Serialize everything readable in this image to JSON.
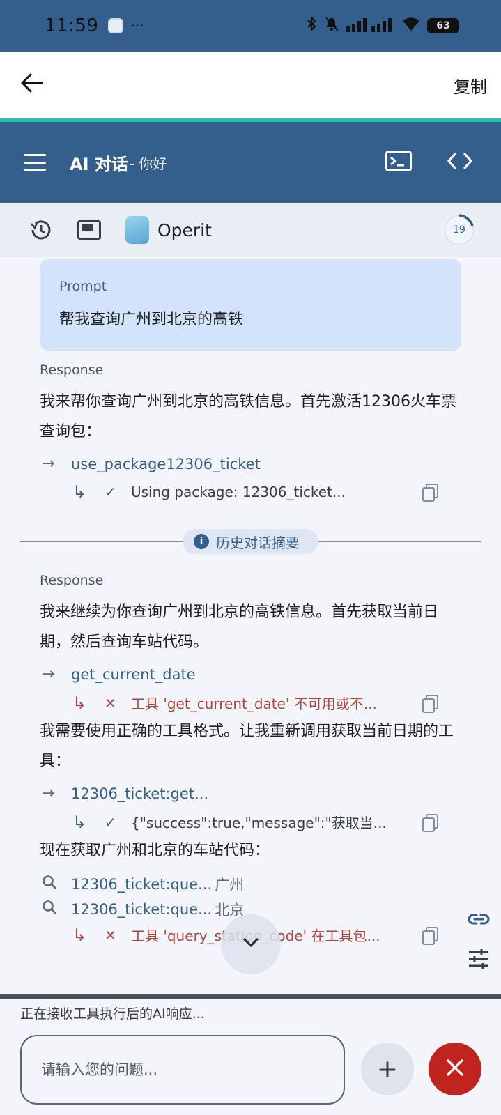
{
  "status_bar": {
    "time": "11:59",
    "dots": "···",
    "battery": "63"
  },
  "top_bar": {
    "back_icon": "back-arrow-icon",
    "copy_label": "复制"
  },
  "app_bar": {
    "title": "AI 对话",
    "subtitle": "- 你好"
  },
  "toolbar": {
    "model_name": "Operit",
    "token_count": "19"
  },
  "prompt": {
    "label": "Prompt",
    "text": "帮我查询广州到北京的高铁"
  },
  "messages": [
    {
      "label": "Response",
      "text": "我来帮你查询广州到北京的高铁信息。首先激活12306火车票查询包：",
      "tool": {
        "name": "use_package",
        "extra": "12306_ticket"
      },
      "result": {
        "text": "Using package: 12306_ticket..."
      }
    }
  ],
  "divider_chip": "历史对话摘要",
  "messages2": {
    "label": "Response",
    "text1": "我来继续为你查询广州到北京的高铁信息。首先获取当前日期，然后查询车站代码。",
    "tool1": {
      "name": "get_current_date"
    },
    "result1": {
      "text": "工具 'get_current_date' 不可用或不..."
    },
    "text2": "我需要使用正确的工具格式。让我重新调用获取当前日期的工具：",
    "tool2": {
      "name": "12306_ticket:get..."
    },
    "result2": {
      "text": "{\"success\":true,\"message\":\"获取当..."
    },
    "text3": "现在获取广州和北京的车站代码：",
    "tool3": {
      "name": "12306_ticket:que...",
      "extra": "广州"
    },
    "tool4": {
      "name": "12306_ticket:que...",
      "extra": "北京"
    },
    "result3": {
      "text": "工具 'query_station_code' 在工具包..."
    }
  },
  "bottom": {
    "status_text": "正在接收工具执行后的AI响应...",
    "input_placeholder": "请输入您的问题...",
    "add_label": "+"
  },
  "colors": {
    "primary": "#345f8d",
    "accent": "#23bfb2",
    "error": "#b3413b",
    "cancel": "#c0241f",
    "prompt_bg": "#d3e3fb"
  }
}
